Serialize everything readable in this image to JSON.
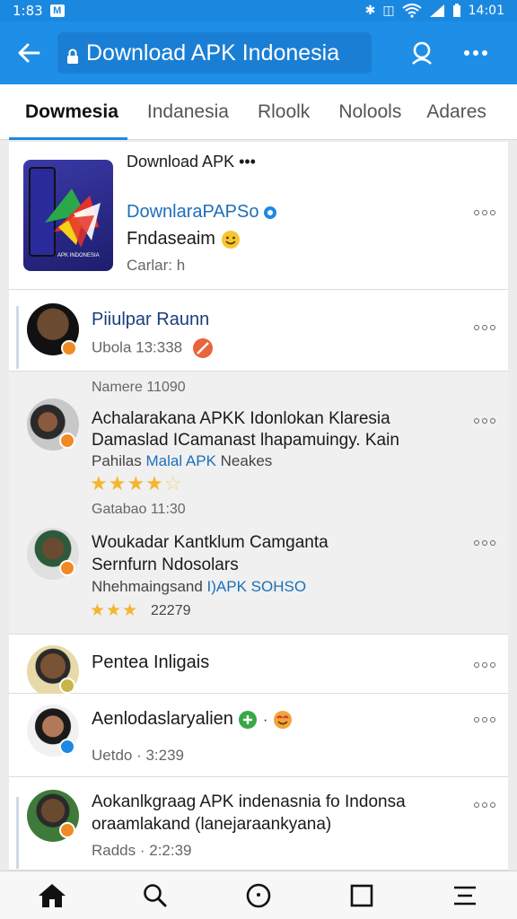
{
  "status_bar": {
    "time": "1:83",
    "notification_icon": "mail-icon",
    "clock": "14:01"
  },
  "app_bar": {
    "title": "Download APK Indonesia",
    "back_icon": "back-arrow-icon",
    "profile_icon": "user-icon",
    "menu_icon": "more-horizontal-icon"
  },
  "tabs": [
    {
      "label": "Dowmesia",
      "active": true
    },
    {
      "label": "Indanesia"
    },
    {
      "label": "Rloolk"
    },
    {
      "label": "Nolools"
    },
    {
      "label": "Adares"
    }
  ],
  "feed": {
    "app_card": {
      "header": "Download APK •••",
      "title": "DownlaraPAPSo",
      "subtitle": "Fndaseaim",
      "meta": "Carlar: h"
    },
    "posts": [
      {
        "name": "Piiulpar Raunn",
        "meta": "Ubola 13:338"
      },
      {
        "header": "Namere 11090",
        "line1": "Achalarakana APKK Idonlokan Klaresia",
        "line2": "Damaslad ICamanast lhapamuingy. Kain",
        "line3a": "Pahilas ",
        "line3b": "Malal APK",
        "line3c": " Neakes",
        "rating": 4.5,
        "meta": "Gatabao 11:30"
      },
      {
        "line1": "Woukadar Kantklum Camganta",
        "line2": "Sernfurn Ndosolars",
        "line3a": "Nhehmaingsand ",
        "line3b": "I)APK SOHSO",
        "rating": 3,
        "rating_text": "22279"
      },
      {
        "name": "Pentea Inligais"
      },
      {
        "name": "Aenlodaslaryalien",
        "meta": "Uetdo · 3:239"
      },
      {
        "line1": "Aokanlkgraag APK indenasnia fo Indonsa",
        "line2": "oraamlakand (lanejaraankyana)",
        "meta": "Radds · 2:2:39"
      }
    ]
  },
  "bottom_nav": [
    "home-icon",
    "search-icon",
    "circle-icon",
    "square-icon",
    "menu-icon"
  ],
  "colors": {
    "primary": "#1e8ee6",
    "accent_star": "#f2b630",
    "badge_orange": "#f08a24"
  }
}
